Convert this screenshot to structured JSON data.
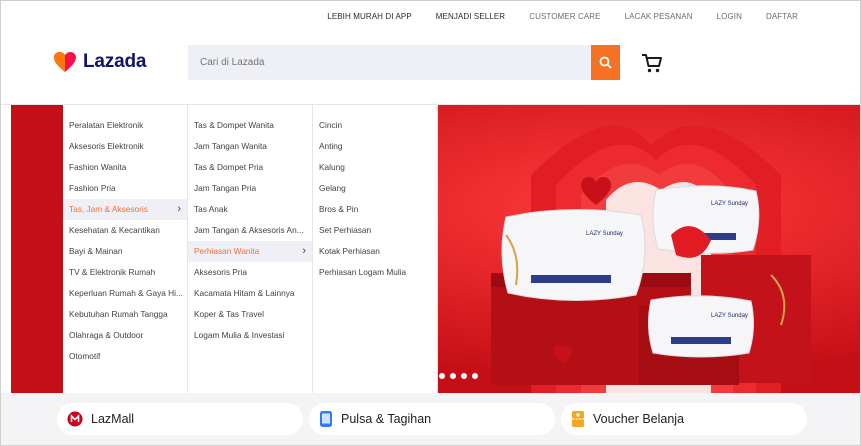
{
  "top_links": [
    "LEBIH MURAH DI APP",
    "MENJADI SELLER",
    "CUSTOMER CARE",
    "LACAK PESANAN",
    "LOGIN",
    "DAFTAR"
  ],
  "brand": {
    "name": "Lazada",
    "heart_color": "#f5114c",
    "text_color": "#0f146d"
  },
  "search": {
    "placeholder": "Cari di Lazada",
    "button_color": "#f57224"
  },
  "categories": {
    "col1": [
      "Peralatan Elektronik",
      "Aksesoris Elektronik",
      "Fashion Wanita",
      "Fashion Pria",
      "Tas, Jam & Aksesoris",
      "Kesehatan & Kecantikan",
      "Bayi & Mainan",
      "TV & Elektronik Rumah",
      "Keperluan Rumah & Gaya Hi...",
      "Kebutuhan Rumah Tangga",
      "Olahraga & Outdoor",
      "Otomotif"
    ],
    "col2": [
      "Tas & Dompet Wanita",
      "Jam Tangan Wanita",
      "Tas & Dompet Pria",
      "Jam Tangan Pria",
      "Tas Anak",
      "Jam Tangan & Aksesoris An...",
      "Perhiasan Wanita",
      "Aksesoris Pria",
      "Kacamata Hitam & Lainnya",
      "Koper & Tas Travel",
      "Logam Mulia & Investasi"
    ],
    "col3": [
      "Cincin",
      "Anting",
      "Kalung",
      "Gelang",
      "Bros & Pin",
      "Set Perhiasan",
      "Kotak Perhiasan",
      "Perhiasan Logam Mulia"
    ],
    "active_col1": 4,
    "active_col2": 6,
    "active_color": "#f36f36"
  },
  "banner": {
    "pillow_brand": "LAZY Sunday",
    "bg_color": "#d8141c"
  },
  "shortcuts": [
    {
      "label": "LazMall",
      "icon": "lazmall-icon"
    },
    {
      "label": "Pulsa & Tagihan",
      "icon": "phone-icon"
    },
    {
      "label": "Voucher Belanja",
      "icon": "voucher-icon"
    }
  ]
}
